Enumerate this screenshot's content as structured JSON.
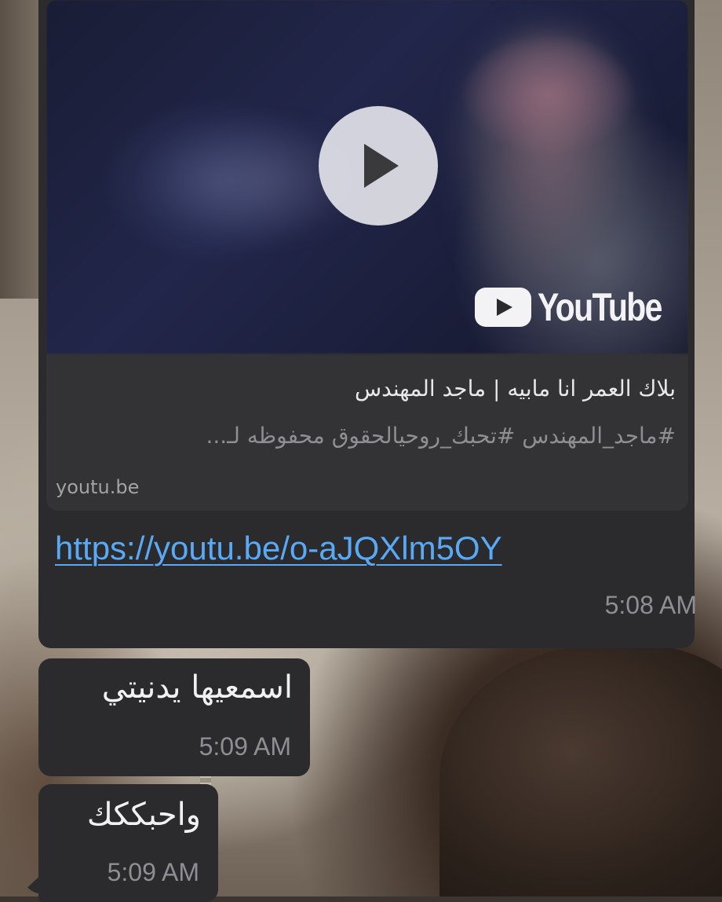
{
  "link_message": {
    "preview": {
      "brand": "YouTube",
      "title": "بلاك العمر انا مابيه | ماجد المهندس",
      "description": "#ماجد_المهندس #تحبك_روحيالحقوق محفوظه لـ...",
      "domain": "youtu.be"
    },
    "url": "https://youtu.be/o-aJQXlm5OY",
    "time": "5:08 AM"
  },
  "messages": [
    {
      "text": "اسمعيها يدنيتي",
      "time": "5:09 AM"
    },
    {
      "text": "واحبككك",
      "time": "5:09 AM"
    }
  ],
  "colors": {
    "bubble": "#2b2b2d",
    "link": "#5aa9f5",
    "timestamp": "#8e8e93"
  }
}
